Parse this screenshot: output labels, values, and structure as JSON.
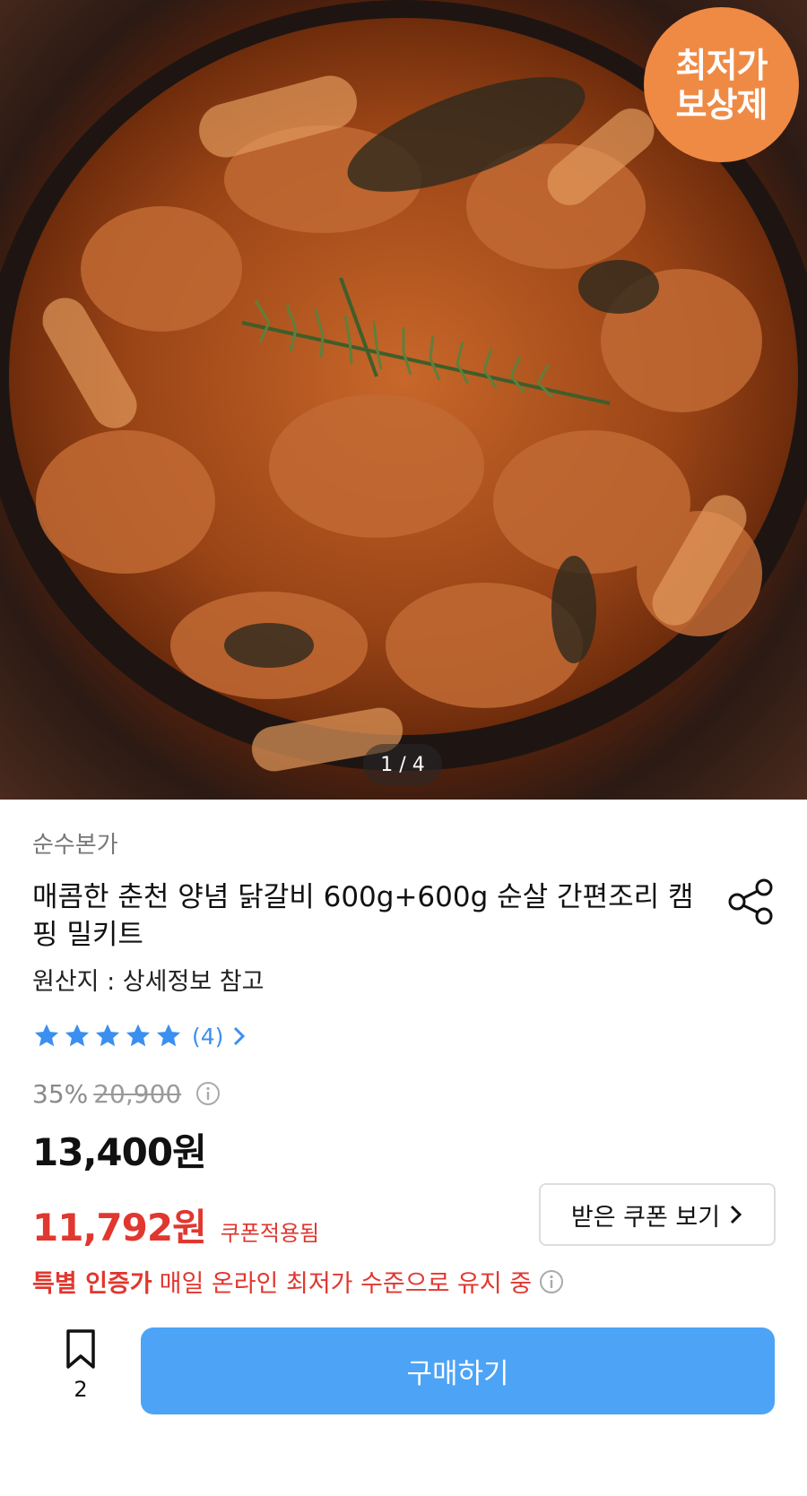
{
  "hero": {
    "badge_line1": "최저가",
    "badge_line2": "보상제",
    "counter": "1 / 4"
  },
  "product": {
    "brand": "순수본가",
    "title": "매콤한 춘천 양념 닭갈비 600g+600g 순살 간편조리 캠핑 밀키트",
    "origin": "원산지 : 상세정보 참고",
    "rating_stars": 5,
    "review_count": "(4)",
    "discount_rate": "35%",
    "original_price": "20,900",
    "price": "13,400원",
    "coupon_price": "11,792원",
    "coupon_applied": "쿠폰적용됨",
    "coupon_button": "받은 쿠폰 보기",
    "special_label": "특별 인증가",
    "special_text": "매일 온라인 최저가 수준으로 유지 중"
  },
  "actions": {
    "bookmark_count": "2",
    "buy_label": "구매하기"
  },
  "colors": {
    "accent_blue": "#4da3f5",
    "sale_red": "#e0372f",
    "badge_orange": "#ef8a45",
    "star_blue": "#3b8ff0"
  },
  "icons": [
    "share-icon",
    "star-icon",
    "chevron-right-icon",
    "info-icon",
    "bookmark-icon"
  ]
}
